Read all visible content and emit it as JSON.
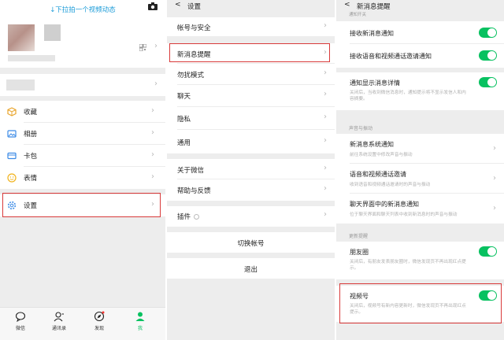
{
  "me": {
    "pull_hint": "↓下拉拍一个视频动态",
    "menu": [
      {
        "label": "收藏",
        "icon": "favorites-cube-icon"
      },
      {
        "label": "相册",
        "icon": "album-icon"
      },
      {
        "label": "卡包",
        "icon": "card-wallet-icon"
      },
      {
        "label": "表情",
        "icon": "sticker-smile-icon"
      },
      {
        "label": "设置",
        "icon": "settings-gear-icon"
      }
    ],
    "tabs": [
      {
        "label": "微信",
        "icon": "chat-bubble-icon"
      },
      {
        "label": "通讯录",
        "icon": "contacts-icon"
      },
      {
        "label": "发现",
        "icon": "discover-compass-icon"
      },
      {
        "label": "我",
        "icon": "me-person-icon"
      }
    ],
    "colors": {
      "accent": "#07c160",
      "link": "#1a9bd8",
      "highlight": "#d93a3a"
    }
  },
  "settings": {
    "title": "设置",
    "back": "<",
    "items": [
      "帐号与安全",
      "新消息提醒",
      "勿扰模式",
      "聊天",
      "隐私",
      "通用",
      "关于微信",
      "帮助与反馈",
      "插件"
    ],
    "switch_account": "切换帐号",
    "logout": "退出"
  },
  "notifications": {
    "title": "新消息提醒",
    "back": "<",
    "top_section": "通知开关",
    "receive_new": "接收新消息通知",
    "receive_call": "接收语音和视频通话邀请通知",
    "show_detail": "通知显示消息详情",
    "show_detail_desc": "关闭后，当收到微信消息时，通知提示将不显示发信人和内容摘要。",
    "sound_section": "声音与振动",
    "system_notice": "新消息系统通知",
    "system_notice_desc": "前往系统设置中修改声音与振动",
    "call_invite": "语音和视频通话邀请",
    "call_invite_desc": "收到语音和视频通话邀请时的声音与振动",
    "in_app": "聊天界面中的新消息通知",
    "in_app_desc": "位于聊天界面和聊天列表中收到新消息时的声音与振动",
    "update_section": "更新提醒",
    "moments": "朋友圈",
    "moments_desc": "关闭后，有朋友发表朋友圈时，微信发现页不再出现红点提示。",
    "channels": "视频号",
    "channels_desc": "关闭后，视频号有新内容更新时，微信发现页不再出现红点提示。"
  }
}
